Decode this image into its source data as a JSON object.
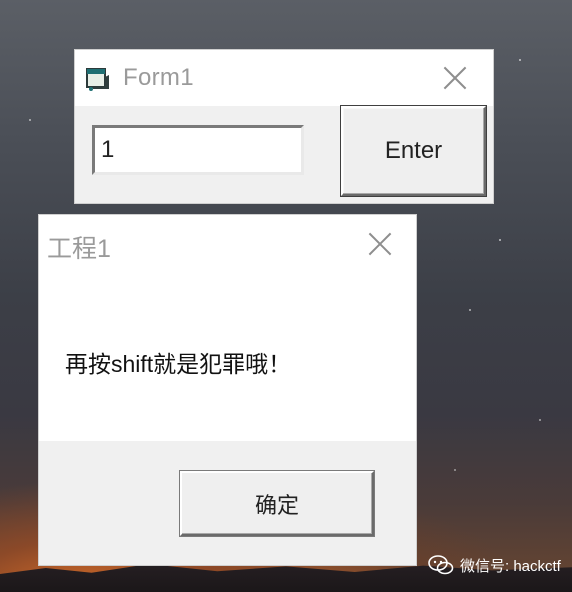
{
  "form1": {
    "title": "Form1",
    "input_value": "1",
    "enter_label": "Enter"
  },
  "msgbox": {
    "title": "工程1",
    "message": "再按shift就是犯罪哦！",
    "ok_label": "确定"
  },
  "watermark": {
    "text": "微信号: hackctf"
  },
  "icons": {
    "form_icon": "vb-form-icon",
    "close": "close-icon",
    "watermark": "wechat-icon"
  },
  "colors": {
    "window_bg": "#f0f0f0",
    "titlebar_bg": "#ffffff",
    "title_text": "#9a9a9a"
  }
}
